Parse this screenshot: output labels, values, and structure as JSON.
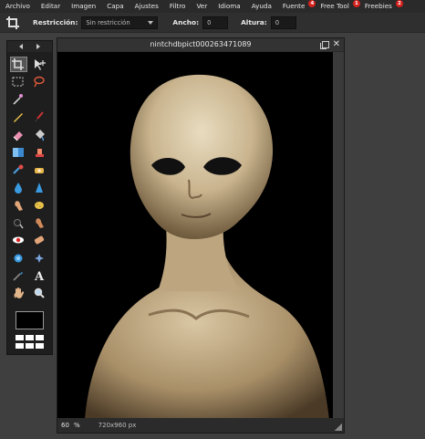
{
  "menu": [
    {
      "label": "Archivo"
    },
    {
      "label": "Editar"
    },
    {
      "label": "Imagen"
    },
    {
      "label": "Capa"
    },
    {
      "label": "Ajustes"
    },
    {
      "label": "Filtro"
    },
    {
      "label": "Ver"
    },
    {
      "label": "Idioma"
    },
    {
      "label": "Ayuda"
    },
    {
      "label": "Fuente",
      "badge": "4"
    },
    {
      "label": "Free Tool",
      "badge": "1"
    },
    {
      "label": "Freebies",
      "badge": "2"
    }
  ],
  "options": {
    "restriction_label": "Restricción:",
    "restriction_value": "Sin restricción",
    "width_label": "Ancho:",
    "width_value": "0",
    "height_label": "Altura:",
    "height_value": "0"
  },
  "tools": [
    "crop-icon",
    "move-icon",
    "marquee-icon",
    "lasso-icon",
    "magic-wand-icon",
    "",
    "pencil-icon",
    "brush-icon",
    "eraser-icon",
    "paint-bucket-icon",
    "gradient-icon",
    "clone-stamp-icon",
    "color-replace-icon",
    "healing-icon",
    "blur-icon",
    "sharpen-icon",
    "smudge-icon",
    "sponge-icon",
    "burn-icon",
    "dodge-icon",
    "red-eye-icon",
    "spot-heal-icon",
    "bloat-icon",
    "pinch-icon",
    "color-picker-icon",
    "type-icon",
    "hand-icon",
    "zoom-icon"
  ],
  "image_window": {
    "title": "nintchdbpict000263471089",
    "zoom": "60",
    "zoom_unit": "%",
    "dimensions": "720x960 px"
  },
  "colors": {
    "accent_badge": "#d6201c",
    "foreground_swatch": "#000000"
  }
}
